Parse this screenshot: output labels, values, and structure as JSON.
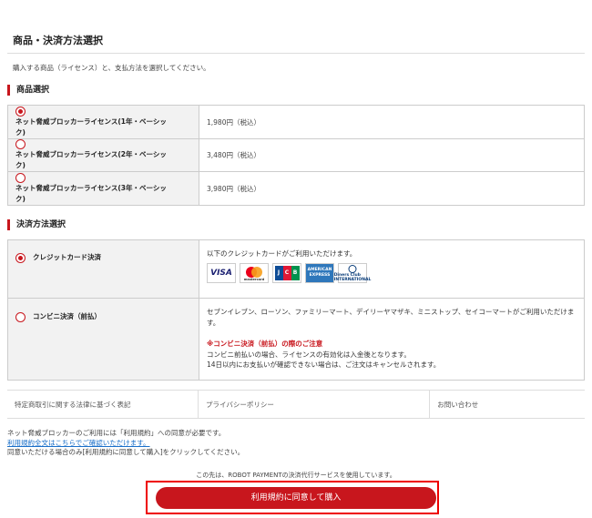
{
  "page_title": "商品・決済方法選択",
  "intro": "購入する商品（ライセンス）と、支払方法を選択してください。",
  "product_section": {
    "title": "商品選択",
    "items": [
      {
        "name": "ネット脅威ブロッカーライセンス(1年・ベーシック)",
        "price": "1,980円（税込）",
        "selected": true
      },
      {
        "name": "ネット脅威ブロッカーライセンス(2年・ベーシック)",
        "price": "3,480円（税込）",
        "selected": false
      },
      {
        "name": "ネット脅威ブロッカーライセンス(3年・ベーシック)",
        "price": "3,980円（税込）",
        "selected": false
      }
    ]
  },
  "payment_section": {
    "title": "決済方法選択",
    "credit": {
      "label": "クレジットカード決済",
      "desc": "以下のクレジットカードがご利用いただけます。",
      "cards": [
        "VISA",
        "mastercard",
        "JCB",
        "AMERICAN EXPRESS",
        "Diners Club INTERNATIONAL"
      ]
    },
    "konbini": {
      "label": "コンビニ決済（前払）",
      "desc": "セブンイレブン、ローソン、ファミリーマート、デイリーヤマザキ、ミニストップ、セイコーマートがご利用いただけます。",
      "note_title": "※コンビニ決済（前払）の際のご注意",
      "note_line1": "コンビニ前払いの場合、ライセンスの有効化は入金後となります。",
      "note_line2": "14日以内にお支払いが確認できない場合は、ご注文はキャンセルされます。"
    }
  },
  "footer_links": [
    "特定商取引に関する法律に基づく表記",
    "プライバシーポリシー",
    "お問い合わせ"
  ],
  "terms": {
    "line1": "ネット脅威ブロッカーのご利用には「利用規約」への同意が必要です。",
    "link": "利用規約全文はこちらでご確認いただけます。",
    "line3": "同意いただける場合のみ[利用規約に同意して購入]をクリックしてください。"
  },
  "service_note": "この先は、ROBOT PAYMENTの決済代行サービスを使用しています。",
  "submit_label": "利用規約に同意して購入",
  "colors": {
    "accent": "#c8161d",
    "link": "#1a6fc9"
  }
}
